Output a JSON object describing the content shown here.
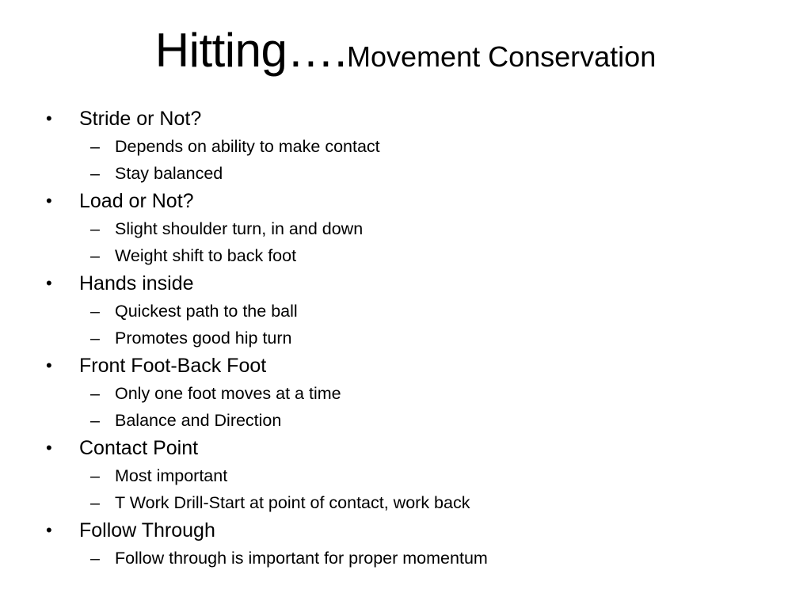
{
  "slide": {
    "title": {
      "main": "Hitting….",
      "sub": "Movement Conservation"
    },
    "bullets": [
      {
        "label": "Stride or Not?",
        "subitems": [
          "Depends on ability to make contact",
          "Stay balanced"
        ]
      },
      {
        "label": "Load or Not?",
        "subitems": [
          "Slight shoulder turn, in and down",
          "Weight shift to back foot"
        ]
      },
      {
        "label": "Hands inside",
        "subitems": [
          "Quickest path to the ball",
          "Promotes good hip turn"
        ]
      },
      {
        "label": "Front Foot-Back Foot",
        "subitems": [
          "Only one foot moves at a time",
          "Balance and Direction"
        ]
      },
      {
        "label": "Contact Point",
        "subitems": [
          "Most important",
          "T Work Drill-Start at point of contact, work back"
        ]
      },
      {
        "label": "Follow Through",
        "subitems": [
          "Follow through is important for proper momentum"
        ]
      }
    ],
    "glyphs": {
      "bullet": "•",
      "dash": "–"
    }
  }
}
